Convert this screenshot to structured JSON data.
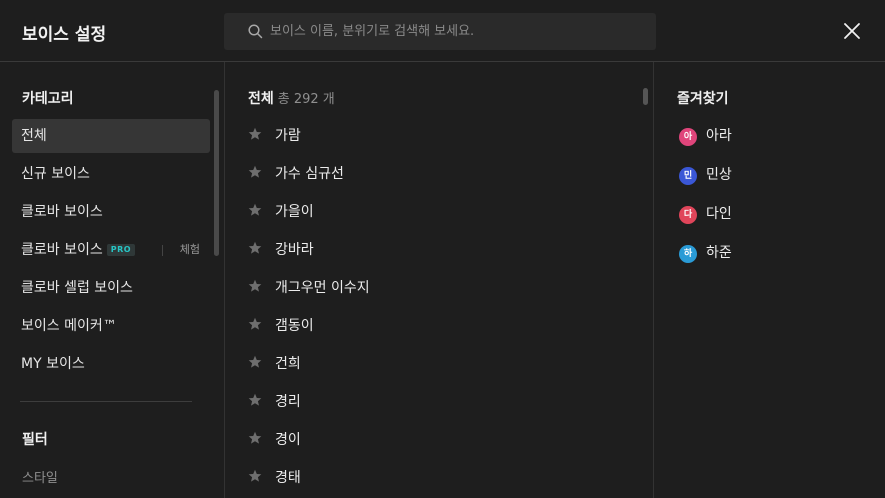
{
  "header": {
    "title": "보이스 설정",
    "search_placeholder": "보이스 이름, 분위기로 검색해 보세요.",
    "icons": {
      "search": "search-icon",
      "close": "close-icon"
    }
  },
  "categories": {
    "heading": "카테고리",
    "items": [
      {
        "label": "전체",
        "active": true
      },
      {
        "label": "신규 보이스"
      },
      {
        "label": "클로바 보이스"
      },
      {
        "label": "클로바 보이스",
        "badge": "PRO",
        "trial": "체험"
      },
      {
        "label": "클로바 셀럽 보이스"
      },
      {
        "label": "보이스 메이커™"
      },
      {
        "label": "MY 보이스"
      }
    ]
  },
  "filter": {
    "heading": "필터",
    "sub": "스타일"
  },
  "voices": {
    "heading": "전체",
    "count": "총 292 개",
    "items": [
      "가람",
      "가수 심규선",
      "가을이",
      "강바라",
      "개그우먼 이수지",
      "갬동이",
      "건희",
      "경리",
      "경이",
      "경태"
    ]
  },
  "favorites": {
    "heading": "즐겨찾기",
    "items": [
      {
        "initial": "아",
        "name": "아라",
        "color": "#e0457b"
      },
      {
        "initial": "민",
        "name": "민상",
        "color": "#3a57d6"
      },
      {
        "initial": "다",
        "name": "다인",
        "color": "#e0455a"
      },
      {
        "initial": "하",
        "name": "하준",
        "color": "#2a9bd6"
      }
    ]
  },
  "colors": {
    "background": "#1e1e1e",
    "active_item": "#363636",
    "pro_badge": "#27c5c5"
  }
}
